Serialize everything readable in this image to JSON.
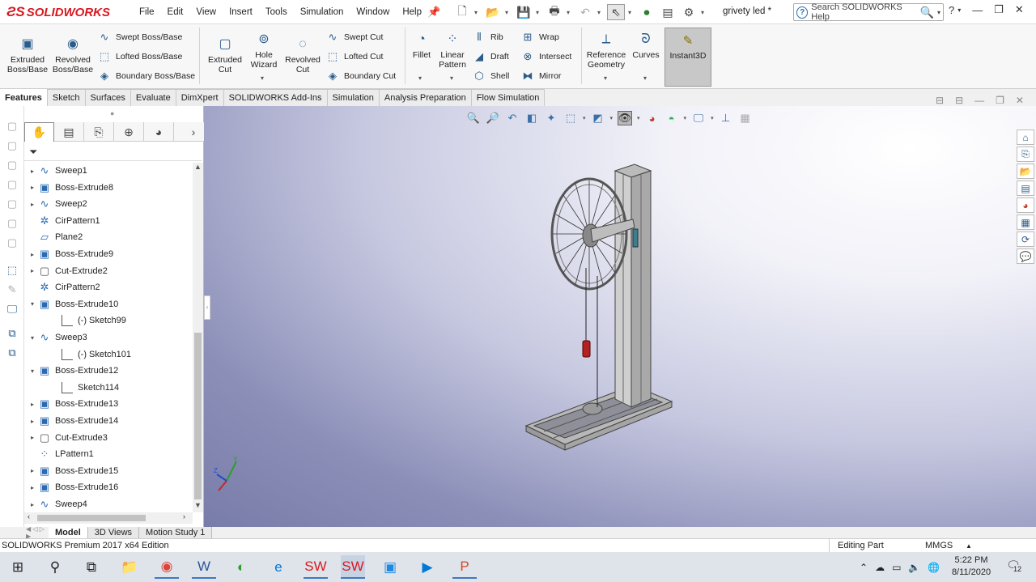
{
  "app": {
    "brand": "SOLIDWORKS",
    "document_title": "grivety led *"
  },
  "menu": [
    "File",
    "Edit",
    "View",
    "Insert",
    "Tools",
    "Simulation",
    "Window",
    "Help"
  ],
  "search": {
    "placeholder": "Search SOLIDWORKS Help"
  },
  "ribbon": {
    "extruded_boss": "Extruded Boss/Base",
    "revolved_boss": "Revolved Boss/Base",
    "swept_boss": "Swept Boss/Base",
    "lofted_boss": "Lofted Boss/Base",
    "boundary_boss": "Boundary Boss/Base",
    "extruded_cut": "Extruded Cut",
    "hole_wizard": "Hole Wizard",
    "revolved_cut": "Revolved Cut",
    "swept_cut": "Swept Cut",
    "lofted_cut": "Lofted Cut",
    "boundary_cut": "Boundary Cut",
    "fillet": "Fillet",
    "linear_pattern": "Linear Pattern",
    "rib": "Rib",
    "draft": "Draft",
    "shell": "Shell",
    "wrap": "Wrap",
    "intersect": "Intersect",
    "mirror": "Mirror",
    "reference_geometry": "Reference Geometry",
    "curves": "Curves",
    "instant3d": "Instant3D"
  },
  "command_tabs": [
    "Features",
    "Sketch",
    "Surfaces",
    "Evaluate",
    "DimXpert",
    "SOLIDWORKS Add-Ins",
    "Simulation",
    "Analysis Preparation",
    "Flow Simulation"
  ],
  "tree": [
    {
      "label": "Sweep1",
      "icon": "sweep-icon"
    },
    {
      "label": "Boss-Extrude8",
      "icon": "boss-extrude-icon"
    },
    {
      "label": "Sweep2",
      "icon": "sweep-icon"
    },
    {
      "label": "CirPattern1",
      "icon": "circular-pattern-icon"
    },
    {
      "label": "Plane2",
      "icon": "plane-icon"
    },
    {
      "label": "Boss-Extrude9",
      "icon": "boss-extrude-icon"
    },
    {
      "label": "Cut-Extrude2",
      "icon": "cut-extrude-icon"
    },
    {
      "label": "CirPattern2",
      "icon": "circular-pattern-icon"
    },
    {
      "label": "Boss-Extrude10",
      "icon": "boss-extrude-icon"
    },
    {
      "label": "(-) Sketch99",
      "icon": "sketch-icon"
    },
    {
      "label": "Sweep3",
      "icon": "sweep-icon"
    },
    {
      "label": "(-) Sketch101",
      "icon": "sketch-icon"
    },
    {
      "label": "Boss-Extrude12",
      "icon": "boss-extrude-icon"
    },
    {
      "label": "Sketch114",
      "icon": "sketch-icon"
    },
    {
      "label": "Boss-Extrude13",
      "icon": "boss-extrude-icon"
    },
    {
      "label": "Boss-Extrude14",
      "icon": "boss-extrude-icon"
    },
    {
      "label": "Cut-Extrude3",
      "icon": "cut-extrude-icon"
    },
    {
      "label": "LPattern1",
      "icon": "linear-pattern-icon"
    },
    {
      "label": "Boss-Extrude15",
      "icon": "boss-extrude-icon"
    },
    {
      "label": "Boss-Extrude16",
      "icon": "boss-extrude-icon"
    },
    {
      "label": "Sweep4",
      "icon": "sweep-icon"
    }
  ],
  "bottom_tabs": [
    "Model",
    "3D Views",
    "Motion Study 1"
  ],
  "status": {
    "edition": "SOLIDWORKS Premium 2017 x64 Edition",
    "mode": "Editing Part",
    "units": "MMGS"
  },
  "clock": {
    "time": "5:22 PM",
    "date": "8/11/2020"
  },
  "notifications": {
    "count": "12"
  },
  "colors": {
    "brand_red": "#d71920",
    "accent_blue": "#2a5d8c",
    "taskbar": "#dfe4ea",
    "model_weight_red": "#b22222"
  }
}
